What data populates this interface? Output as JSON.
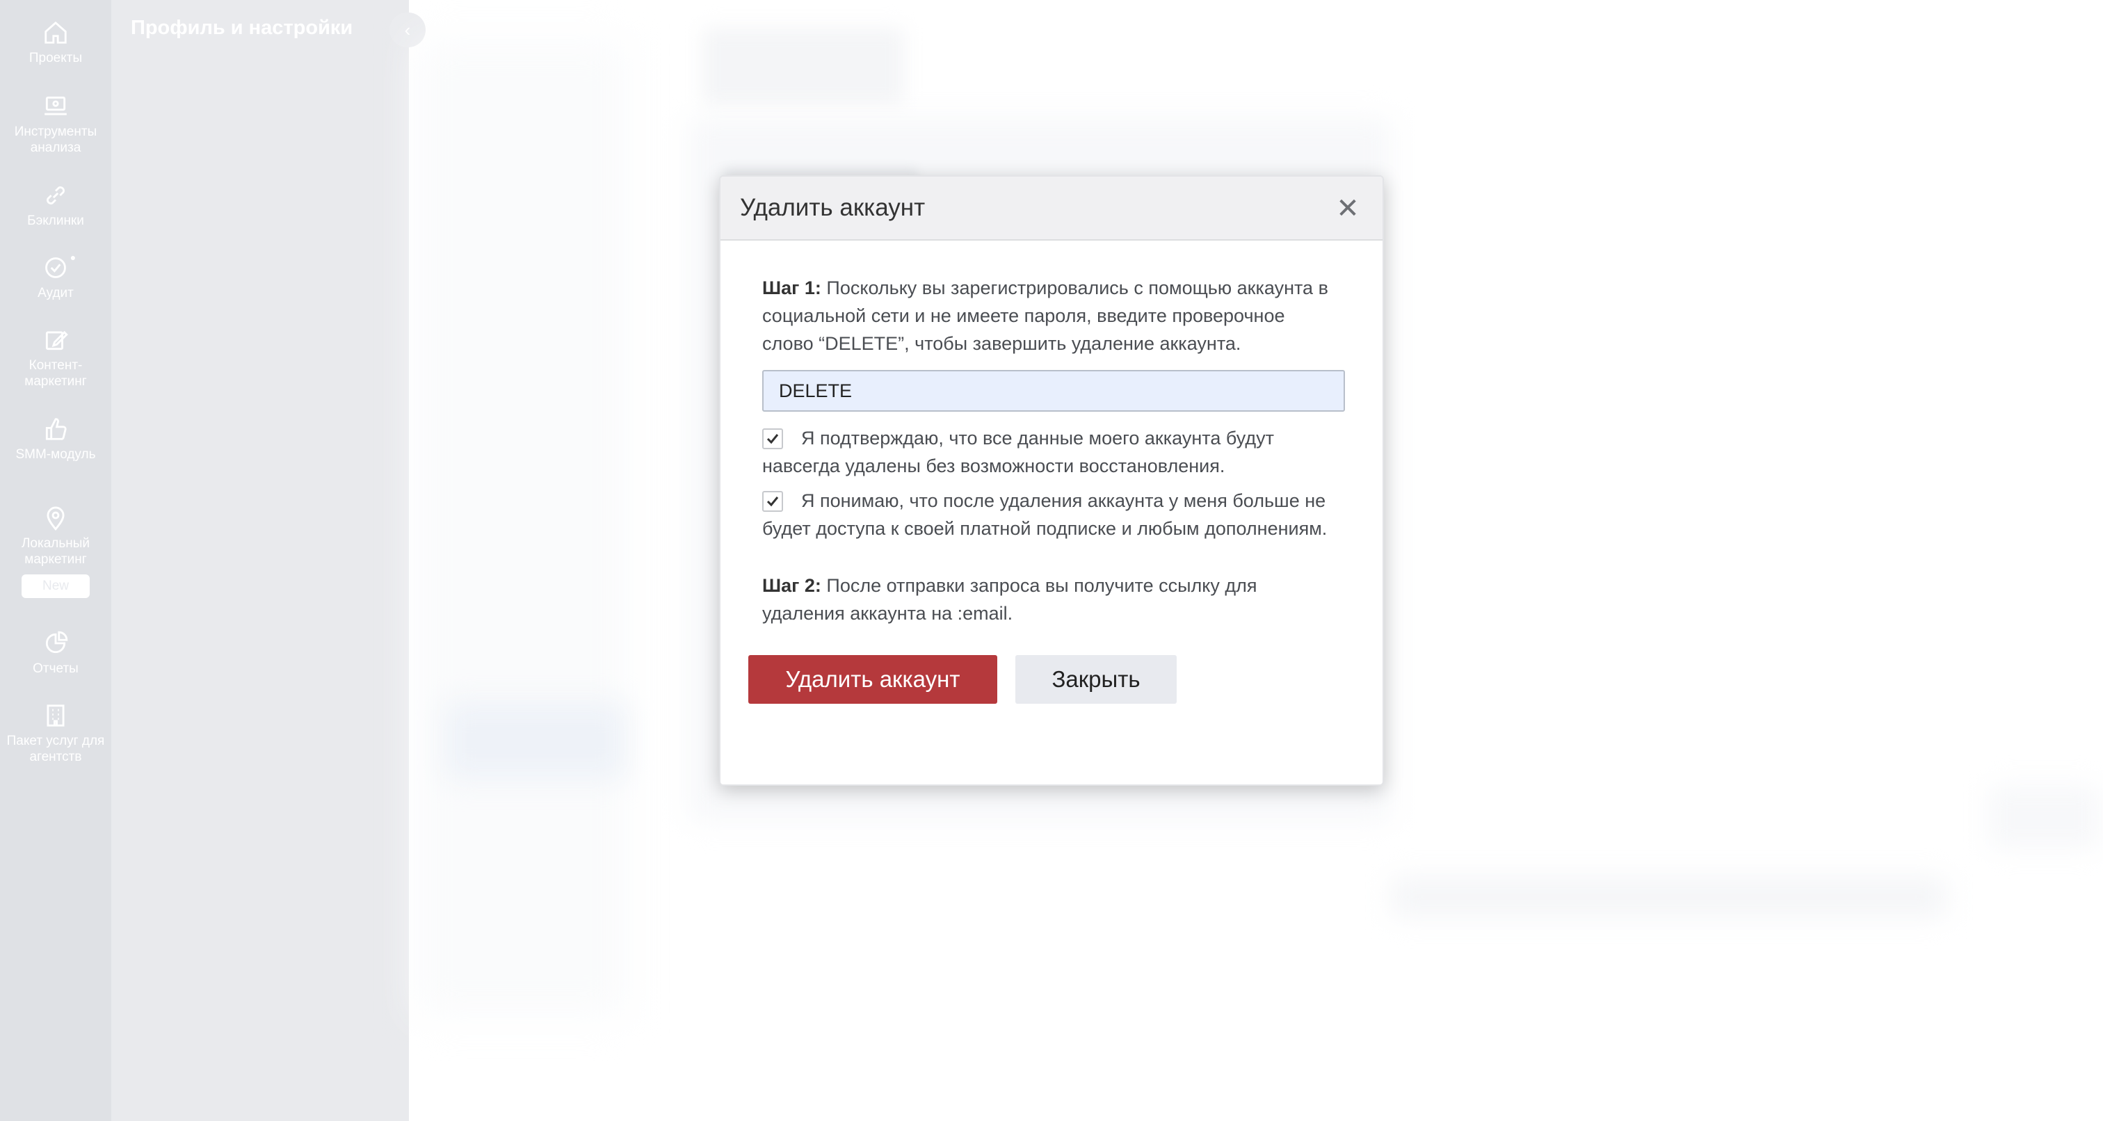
{
  "rail": {
    "items": [
      {
        "label": "Проекты",
        "icon": "home-icon"
      },
      {
        "label": "Инструменты анализа",
        "icon": "laptop-icon"
      },
      {
        "label": "Бэклинки",
        "icon": "link-icon"
      },
      {
        "label": "Аудит",
        "icon": "check-circle-icon"
      },
      {
        "label": "Контент-маркетинг",
        "icon": "edit-icon"
      },
      {
        "label": "SMM-модуль",
        "icon": "thumbs-up-icon"
      },
      {
        "label": "Локальный маркетинг",
        "icon": "map-pin-icon",
        "badge": "New"
      },
      {
        "label": "Отчеты",
        "icon": "pie-chart-icon"
      },
      {
        "label": "Пакет услуг для агентств",
        "icon": "building-icon"
      }
    ]
  },
  "side_panel": {
    "title": "Профиль и настройки"
  },
  "modal": {
    "title": "Удалить аккаунт",
    "step1_label": "Шаг 1:",
    "step1_text": " Поскольку вы зарегистрировались с помощью аккаунта в социальной сети и не имеете пароля, введите проверочное слово “DELETE”, чтобы завершить удаление аккаунта.",
    "input_value": "DELETE",
    "checkbox1_text": "Я подтверждаю, что все данные моего аккаунта будут навсегда удалены без возможности восстановления.",
    "checkbox1_checked": true,
    "checkbox2_text": "Я понимаю, что после удаления аккаунта у меня больше не будет доступа к своей платной подписке и любым дополнениям.",
    "checkbox2_checked": true,
    "step2_label": "Шаг 2:",
    "step2_text": " После отправки запроса вы получите ссылку для удаления аккаунта на :email.",
    "delete_button": "Удалить аккаунт",
    "close_button": "Закрыть"
  },
  "colors": {
    "danger": "#b5393c",
    "rail_bg": "#dfe1e5",
    "input_bg": "#e8effd"
  }
}
